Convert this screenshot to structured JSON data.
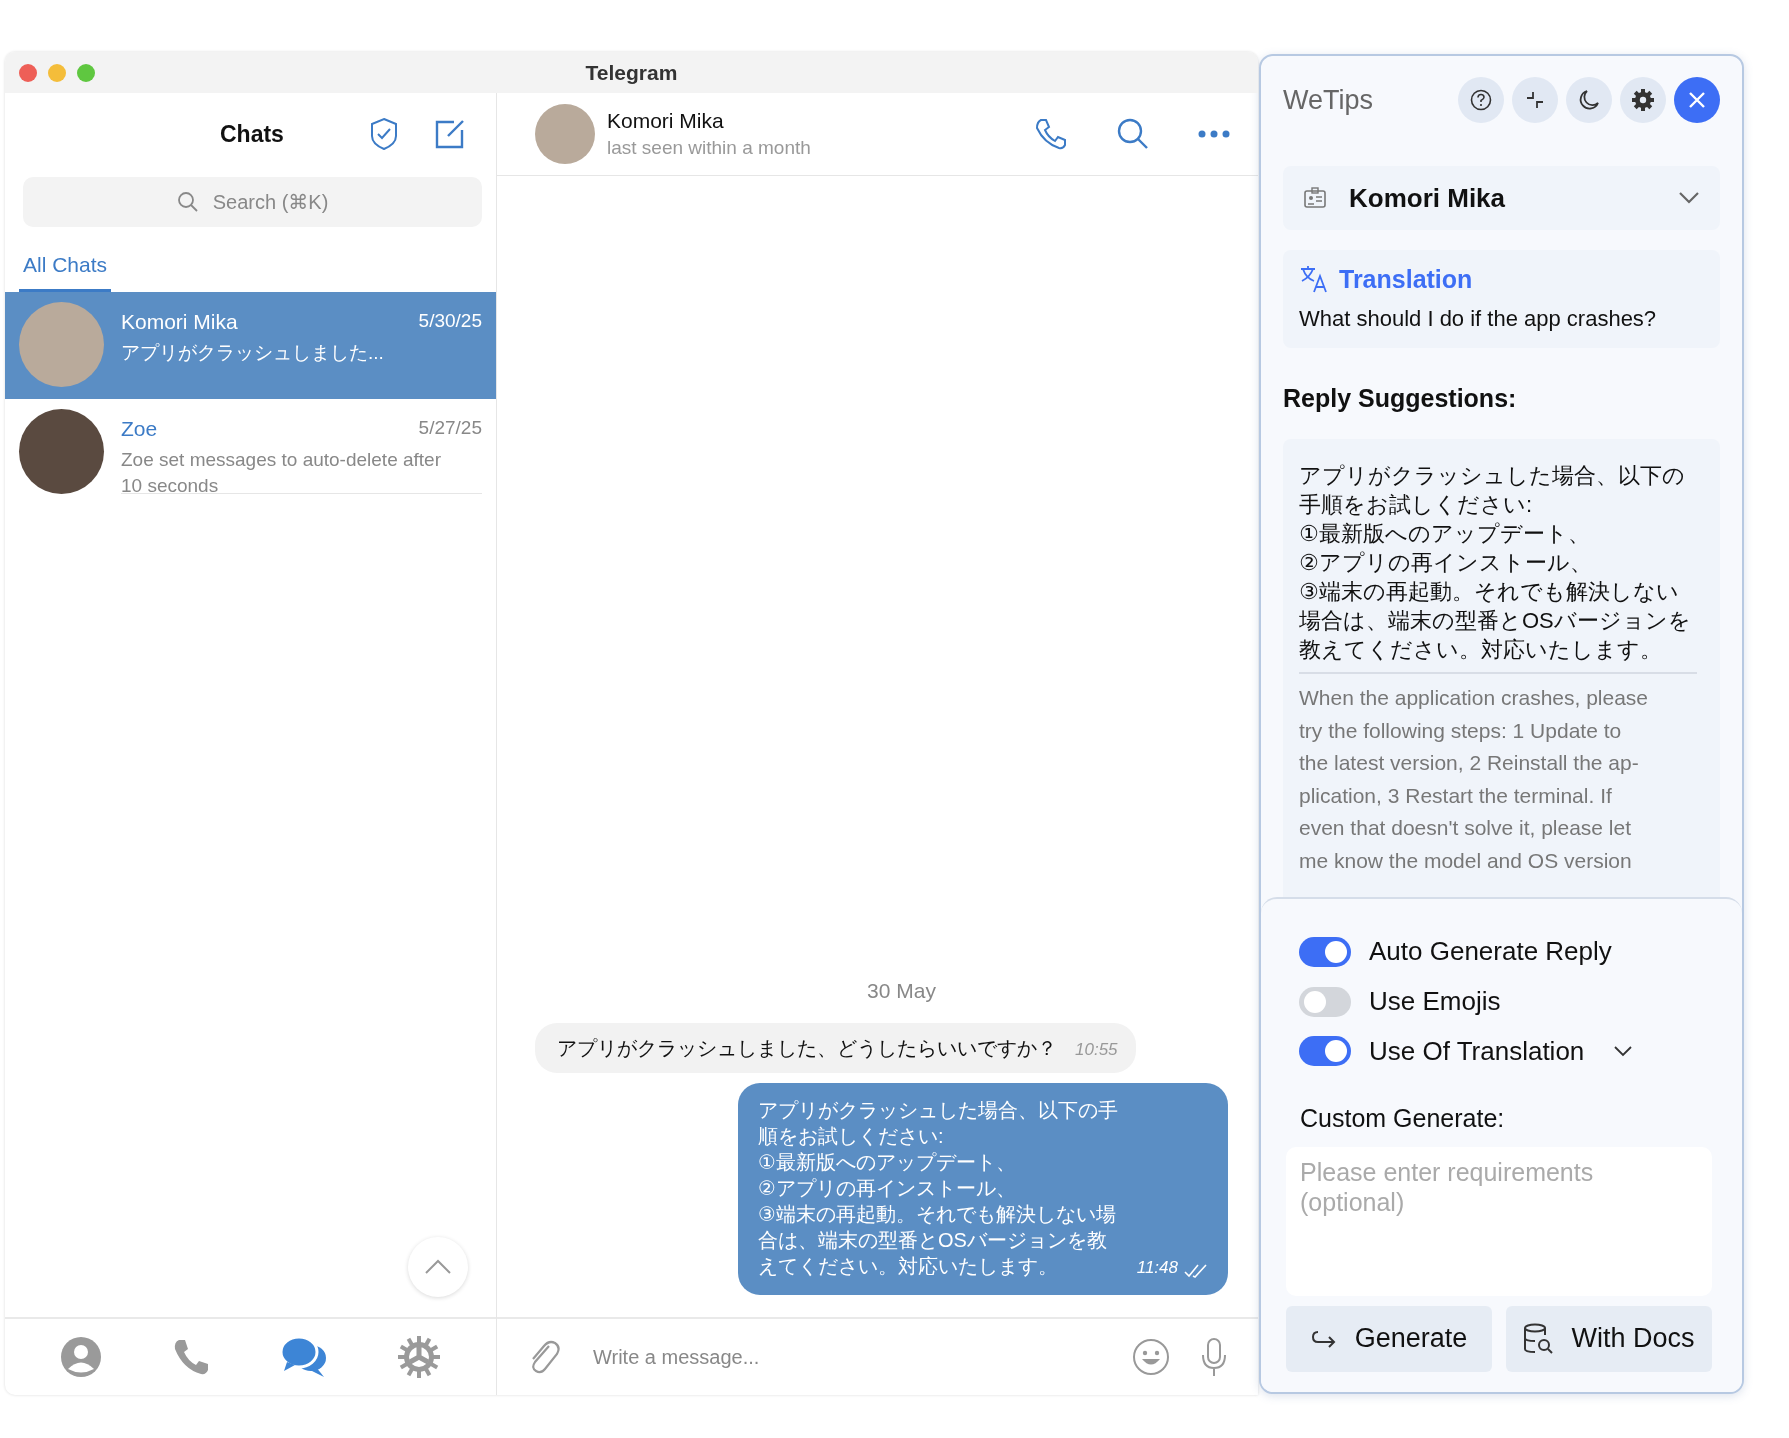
{
  "window": {
    "title": "Telegram"
  },
  "sidebar": {
    "title": "Chats",
    "search": {
      "placeholder": "Search (⌘K)"
    },
    "folders": [
      {
        "label": "All Chats",
        "selected": true
      }
    ],
    "chats": [
      {
        "name": "Komori Mika",
        "date": "5/30/25",
        "preview": "アプリがクラッシュしました...",
        "selected": true
      },
      {
        "name": "Zoe",
        "date": "5/27/25",
        "preview": "Zoe set messages to auto-delete after 10 seconds",
        "selected": false
      }
    ],
    "nav": [
      {
        "kind": "contacts",
        "selected": false
      },
      {
        "kind": "calls",
        "selected": false
      },
      {
        "kind": "chats",
        "selected": true
      },
      {
        "kind": "settings",
        "selected": false
      }
    ]
  },
  "chat": {
    "name": "Komori Mika",
    "status": "last seen within a month",
    "date": "30 May",
    "messages": [
      {
        "kind": "incoming",
        "text": "アプリがクラッシュしました、どうしたらいいですか？",
        "time": "10:55"
      },
      {
        "kind": "outgoing",
        "text": "アプリがクラッシュした場合、以下の手順をお試しください:\n①最新版へのアップデート、\n②アプリの再インストール、\n③端末の再起動。それでも解決しない場合は、端末の型番とOSバージョンを教えてください。対応いたします。",
        "time": "11:48",
        "read": true
      }
    ],
    "composer": {
      "placeholder": "Write a message..."
    }
  },
  "panel": {
    "title": "WeTips",
    "tools": [
      {
        "kind": "help"
      },
      {
        "kind": "collapse"
      },
      {
        "kind": "theme"
      },
      {
        "kind": "settings"
      },
      {
        "kind": "close"
      }
    ],
    "contact": "Komori Mika",
    "translation": {
      "label": "Translation",
      "text": "What should I do if the app crashes?"
    },
    "suggestions_heading": "Reply Suggestions:",
    "suggestion": {
      "original": "アプリがクラッシュした場合、以下の手順をお試しください:\n①最新版へのアップデート、\n②アプリの再インストール、\n③端末の再起動。それでも解決しない場合は、端末の型番とOSバージョンを教えてください。対応いたします。",
      "translation": "When the application crashes, please\n try the following steps: 1 Update to\nthe latest version, 2 Reinstall the ap-\nplication, 3 Restart the terminal. If\neven that doesn't solve it, please let\nme know the model and OS version"
    },
    "toggles": [
      {
        "kind": "toggle",
        "label": "Auto Generate Reply",
        "on": true
      },
      {
        "kind": "toggle",
        "label": "Use Emojis",
        "on": false
      },
      {
        "kind": "toggle-menu",
        "label": "Use Of Translation",
        "on": true
      }
    ],
    "custom": {
      "label": "Custom Generate:",
      "placeholder": "Please enter requirements (optional)"
    },
    "actions": [
      {
        "kind": "generate",
        "label": "Generate"
      },
      {
        "kind": "docs",
        "label": "With Docs"
      }
    ]
  }
}
